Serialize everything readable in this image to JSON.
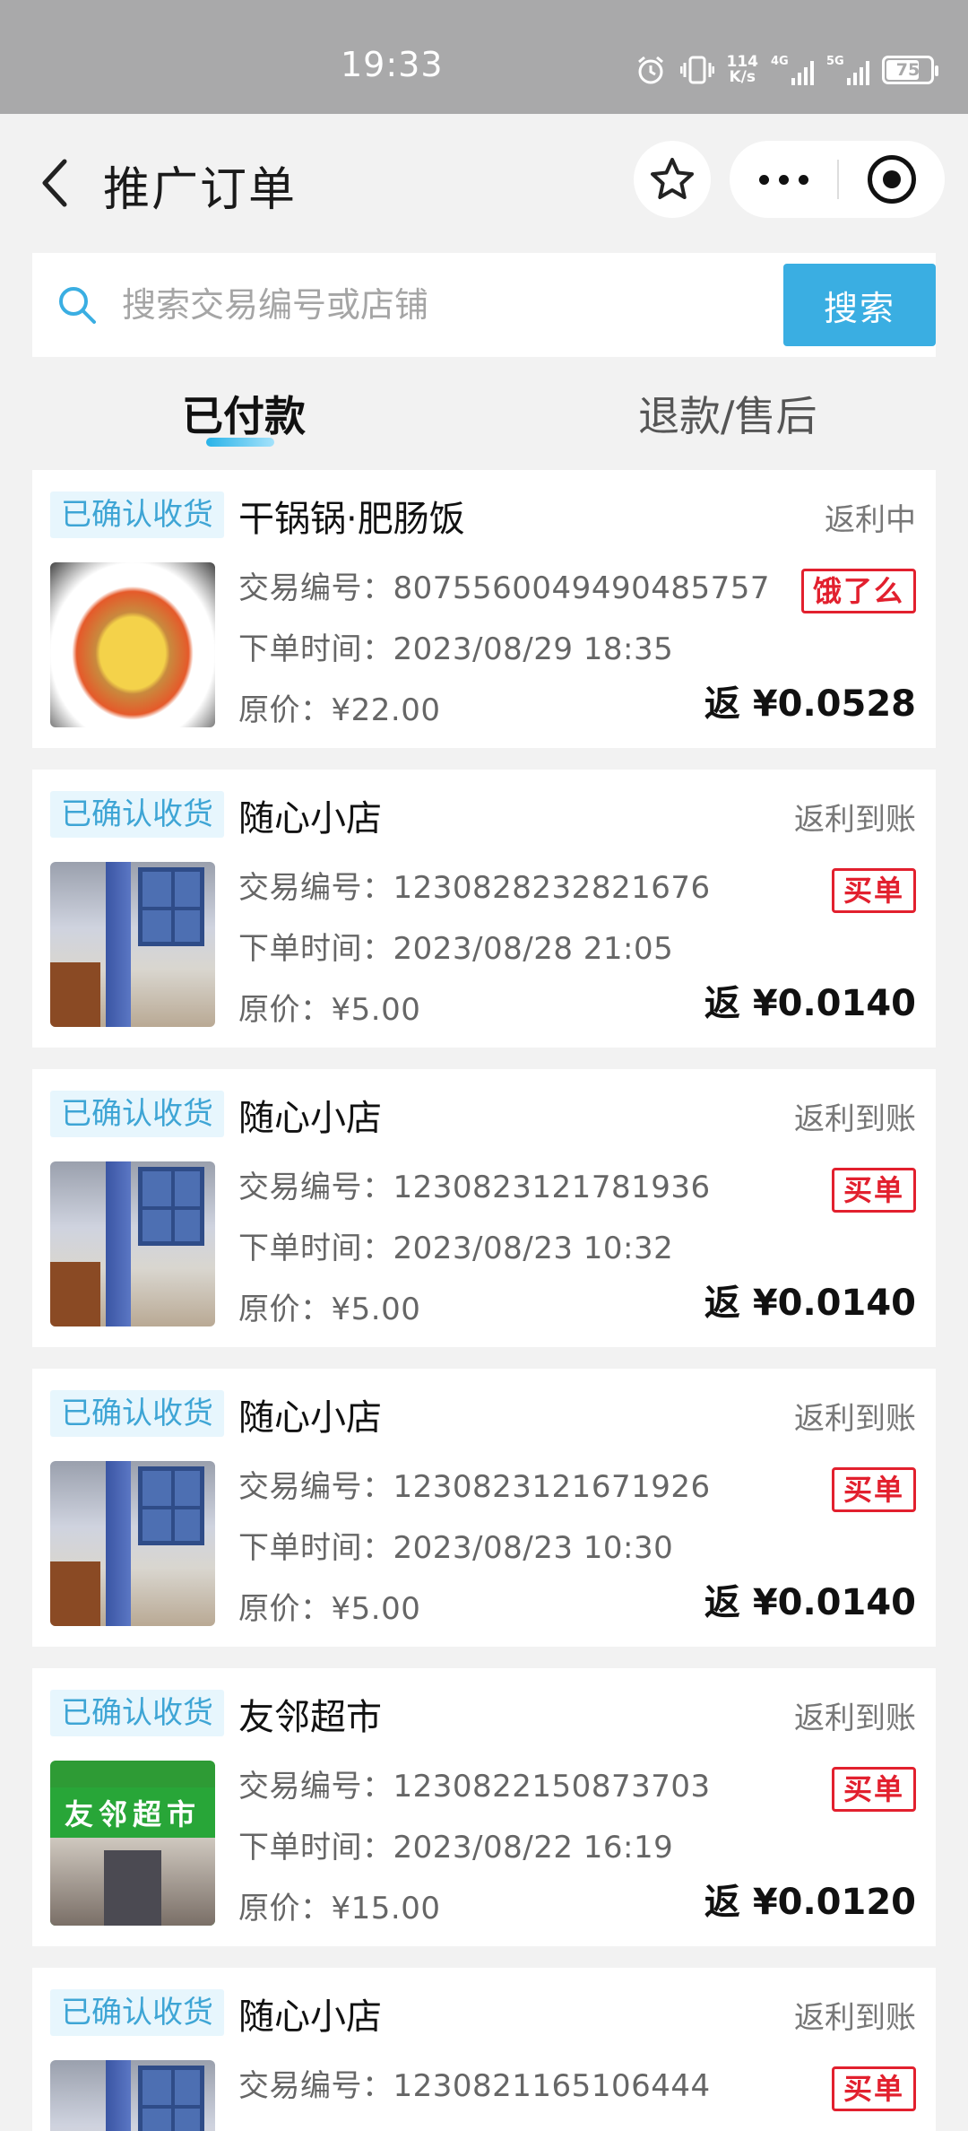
{
  "status_bar": {
    "time": "19:33",
    "speed_top": "114",
    "speed_bottom": "K/s",
    "signal1": "4G",
    "signal2": "5G",
    "battery": "75",
    "battery_level": 0.75
  },
  "header": {
    "title": "推广订单"
  },
  "search": {
    "placeholder": "搜索交易编号或店铺",
    "button": "搜索"
  },
  "tabs": [
    {
      "label": "已付款",
      "active": true
    },
    {
      "label": "退款/售后",
      "active": false
    }
  ],
  "labels": {
    "trade_no": "交易编号：",
    "order_time": "下单时间：",
    "original_price": "原价：",
    "rebate_prefix": "返 "
  },
  "orders": [
    {
      "badge": "已确认收货",
      "shop": "干锅锅·肥肠饭",
      "status": "返利中",
      "trade_no": "807556004949048​5757",
      "order_time": "2023/08/29 18:35",
      "price": "¥22.00",
      "platform": "饿了么",
      "rebate": "¥0.0528",
      "thumb": "food"
    },
    {
      "badge": "已确认收货",
      "shop": "随心小店",
      "status": "返利到账",
      "trade_no": "1230828232821676",
      "order_time": "2023/08/28 21:05",
      "price": "¥5.00",
      "platform": "买单",
      "rebate": "¥0.0140",
      "thumb": "room"
    },
    {
      "badge": "已确认收货",
      "shop": "随心小店",
      "status": "返利到账",
      "trade_no": "1230823121781936",
      "order_time": "2023/08/23 10:32",
      "price": "¥5.00",
      "platform": "买单",
      "rebate": "¥0.0140",
      "thumb": "room"
    },
    {
      "badge": "已确认收货",
      "shop": "随心小店",
      "status": "返利到账",
      "trade_no": "1230823121671926",
      "order_time": "2023/08/23 10:30",
      "price": "¥5.00",
      "platform": "买单",
      "rebate": "¥0.0140",
      "thumb": "room"
    },
    {
      "badge": "已确认收货",
      "shop": "友邻超市",
      "status": "返利到账",
      "trade_no": "1230822150873703",
      "order_time": "2023/08/22 16:19",
      "price": "¥15.00",
      "platform": "买单",
      "rebate": "¥0.0120",
      "thumb": "shop",
      "thumb_text": "友邻超市"
    },
    {
      "badge": "已确认收货",
      "shop": "随心小店",
      "status": "返利到账",
      "trade_no": "1230821165106444",
      "platform": "买单",
      "thumb": "room"
    }
  ],
  "colors": {
    "accent": "#3aaee2",
    "badge_text": "#3ea5d5",
    "platform_red": "#e2202e"
  }
}
